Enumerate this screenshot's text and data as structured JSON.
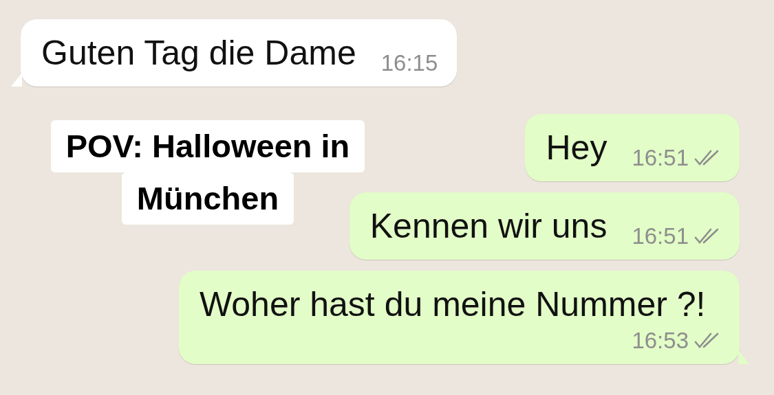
{
  "caption": {
    "lines": [
      "POV: Halloween in",
      "München"
    ]
  },
  "messages": [
    {
      "kind": "incoming",
      "text": "Guten Tag die Dame",
      "time": "16:15",
      "tail": true
    },
    {
      "kind": "outgoing",
      "text": "Hey",
      "time": "16:51",
      "read": false,
      "tail": false
    },
    {
      "kind": "outgoing",
      "text": "Kennen wir uns",
      "time": "16:51",
      "read": false,
      "tail": false
    },
    {
      "kind": "outgoing",
      "text": "Woher hast du meine Nummer ?!",
      "time": "16:53",
      "read": false,
      "tail": true
    }
  ]
}
